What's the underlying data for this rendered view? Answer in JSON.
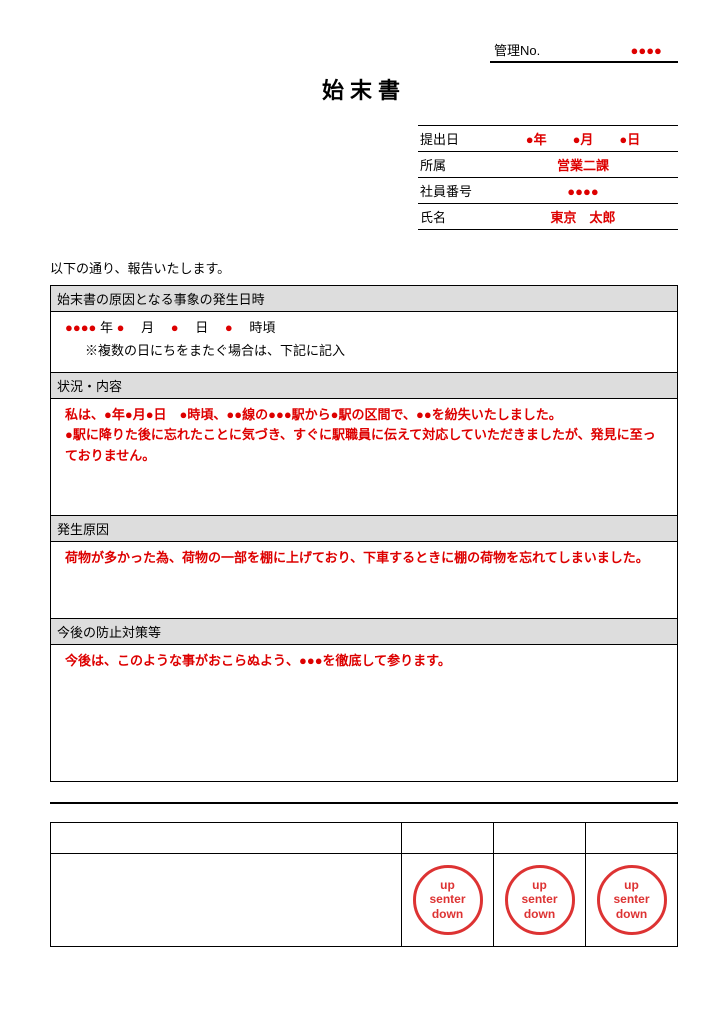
{
  "header": {
    "mgmt_label": "管理No.",
    "mgmt_value": "●●●●"
  },
  "title": "始末書",
  "meta": {
    "date_label": "提出日",
    "date_value": "●年　　●月　　●日",
    "dept_label": "所属",
    "dept_value": "営業二課",
    "empno_label": "社員番号",
    "empno_value": "●●●●",
    "name_label": "氏名",
    "name_value": "東京　太郎"
  },
  "intro": "以下の通り、報告いたします。",
  "sections": {
    "datetime": {
      "head": "始末書の原因となる事象の発生日時",
      "line1_pre": "●●●●",
      "line1_y": " 年 ",
      "line1_m_mark": "●",
      "line1_m": "　月　",
      "line1_d_mark": "●",
      "line1_d": "　日　",
      "line1_t_mark": "●",
      "line1_t": "　時頃",
      "note": "※複数の日にちをまたぐ場合は、下記に記入"
    },
    "situation": {
      "head": "状況・内容",
      "body1": "私は、●年●月●日　●時頃、●●線の●●●駅から●駅の区間で、●●を紛失いたしました。",
      "body2": "●駅に降りた後に忘れたことに気づき、すぐに駅職員に伝えて対応していただきましたが、発見に至っておりません。"
    },
    "cause": {
      "head": "発生原因",
      "body": "荷物が多かった為、荷物の一部を棚に上げており、下車するときに棚の荷物を忘れてしまいました。"
    },
    "prevention": {
      "head": "今後の防止対策等",
      "body": "今後は、このような事がおこらぬよう、●●●を徹底して参ります。"
    }
  },
  "stamp": {
    "l1": "up",
    "l2": "senter",
    "l3": "down"
  }
}
